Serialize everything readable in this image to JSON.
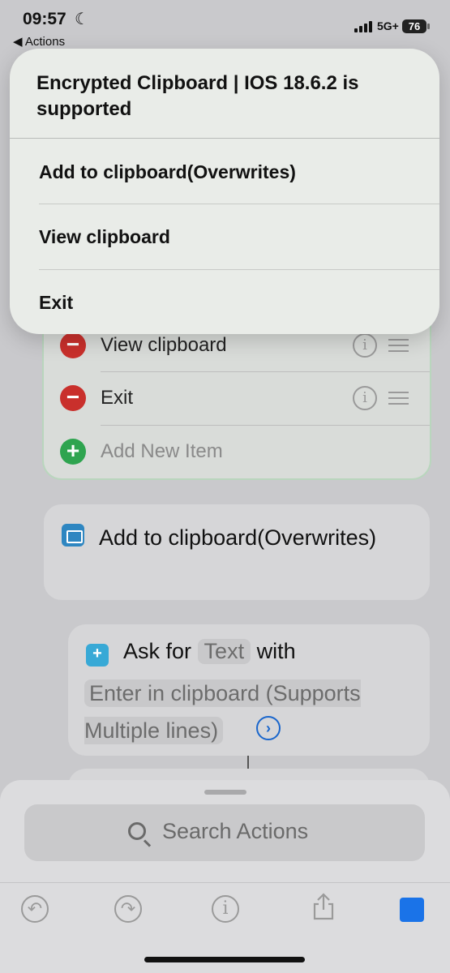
{
  "status_bar": {
    "time": "09:57",
    "back_label": "◀ Actions",
    "network": "5G+",
    "battery": "76"
  },
  "popup": {
    "title": "Encrypted Clipboard | IOS 18.6.2 is supported",
    "items": [
      {
        "label": "Add to clipboard(Overwrites)"
      },
      {
        "label": "View clipboard"
      },
      {
        "label": "Exit"
      }
    ]
  },
  "menu_editor": {
    "items": [
      {
        "label": "View clipboard"
      },
      {
        "label": "Exit"
      }
    ],
    "add_item_placeholder": "Add New Item"
  },
  "action_add": {
    "title": "Add to clipboard(Overwrites)"
  },
  "action_ask": {
    "prefix": "Ask for",
    "type_token": "Text",
    "with_label": "with",
    "prompt": "Enter in clipboard (Supports Multiple lines)"
  },
  "bottom_sheet": {
    "search_placeholder": "Search Actions"
  },
  "colors": {
    "run_button": "#1a73e8",
    "delete": "#c9302c",
    "add": "#2ea44f"
  }
}
